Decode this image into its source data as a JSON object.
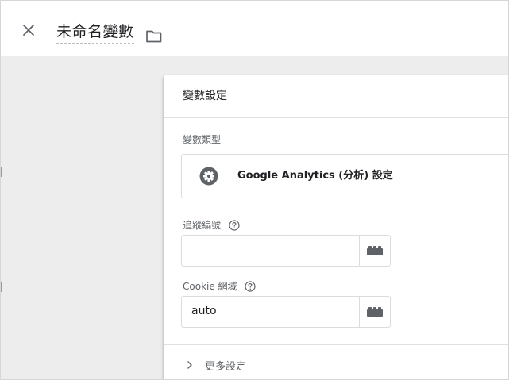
{
  "header": {
    "title": "未命名變數",
    "close_icon": "close-icon",
    "folder_icon": "folder-icon"
  },
  "card": {
    "title": "變數設定",
    "variable_type": {
      "label": "變數類型",
      "value": "Google Analytics (分析) 設定",
      "icon": "gear-icon"
    },
    "fields": [
      {
        "label": "追蹤編號",
        "value": "",
        "help_icon": "help-icon",
        "picker_icon": "lego-brick-icon"
      },
      {
        "label": "Cookie 網域",
        "value": "auto",
        "help_icon": "help-icon",
        "picker_icon": "lego-brick-icon"
      }
    ],
    "more_settings": {
      "label": "更多設定",
      "icon": "chevron-right-icon"
    }
  },
  "colors": {
    "canvas_background": "#ededed",
    "card_background": "#ffffff",
    "icon_gray": "#5f6368",
    "gear_circle": "#5f6368",
    "border": "#dadce0"
  }
}
